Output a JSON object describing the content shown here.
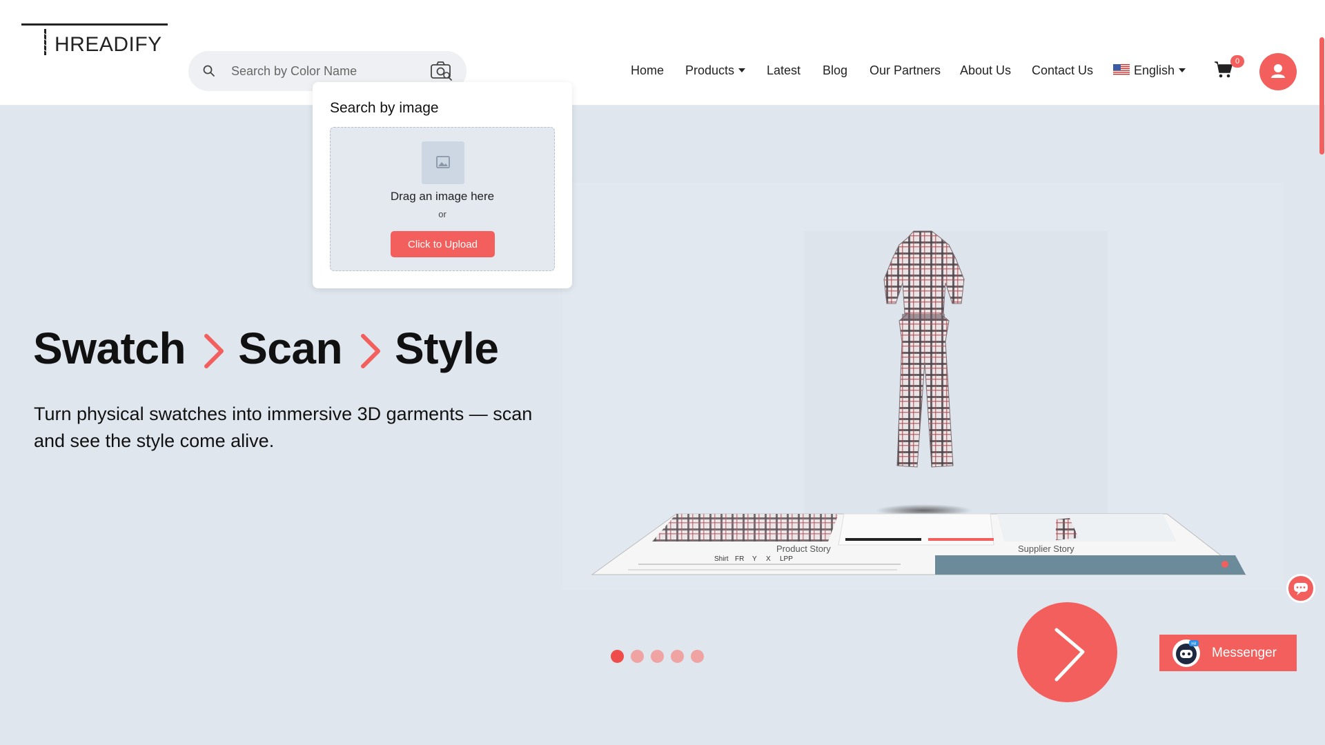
{
  "brand": {
    "logo_text": "HREADIFY"
  },
  "search": {
    "placeholder": "Search by Color Name",
    "value": ""
  },
  "nav": {
    "items": [
      {
        "label": "Home"
      },
      {
        "label": "Products"
      },
      {
        "label": "Latest"
      },
      {
        "label": "Blog"
      },
      {
        "label": "Our Partners"
      },
      {
        "label": "About Us"
      },
      {
        "label": "Contact Us"
      }
    ],
    "language": "English"
  },
  "cart": {
    "count": "0"
  },
  "image_search": {
    "title": "Search by image",
    "drag_text": "Drag an image here",
    "or_text": "or",
    "upload_label": "Click to Upload"
  },
  "hero": {
    "words": [
      "Swatch",
      "Scan",
      "Style"
    ],
    "description": "Turn physical swatches into immersive 3D garments — scan and see the style come alive."
  },
  "showcase": {
    "panel_labels": [
      "Product Story",
      "Supplier Story"
    ],
    "table_headers": [
      "Shirt",
      "FR",
      "Y",
      "X",
      "LPP"
    ]
  },
  "carousel": {
    "slide_count": 5,
    "active_index": 0
  },
  "messenger": {
    "label": "Messenger",
    "bot_badge": "Hi!"
  },
  "colors": {
    "accent": "#f25f5c",
    "background": "#dfe6ee",
    "header": "#ffffff"
  }
}
